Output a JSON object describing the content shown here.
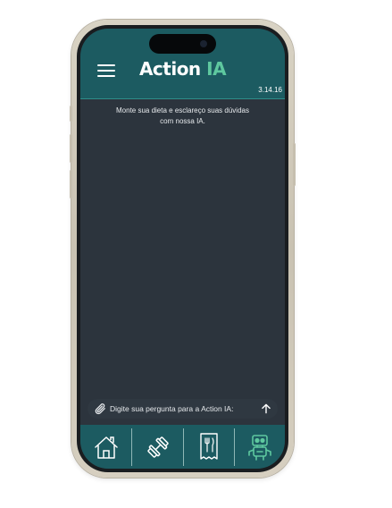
{
  "app": {
    "logo_part1": "Acti",
    "logo_part2": "on",
    "logo_part3": "IA",
    "version": "3.14.16"
  },
  "chat": {
    "intro_line1": "Monte sua dieta e esclareço suas dúvidas",
    "intro_line2": "com nossa IA."
  },
  "input": {
    "placeholder": "Digite sua pergunta para a Action IA:"
  },
  "nav": {
    "items": [
      {
        "name": "home",
        "icon": "home-icon"
      },
      {
        "name": "workout",
        "icon": "dumbbell-icon"
      },
      {
        "name": "diet",
        "icon": "receipt-cutlery-icon"
      },
      {
        "name": "ai",
        "icon": "robot-icon",
        "active": true
      }
    ]
  },
  "colors": {
    "header": "#1c5b61",
    "background": "#2c343d",
    "accent": "#5ec89f"
  }
}
